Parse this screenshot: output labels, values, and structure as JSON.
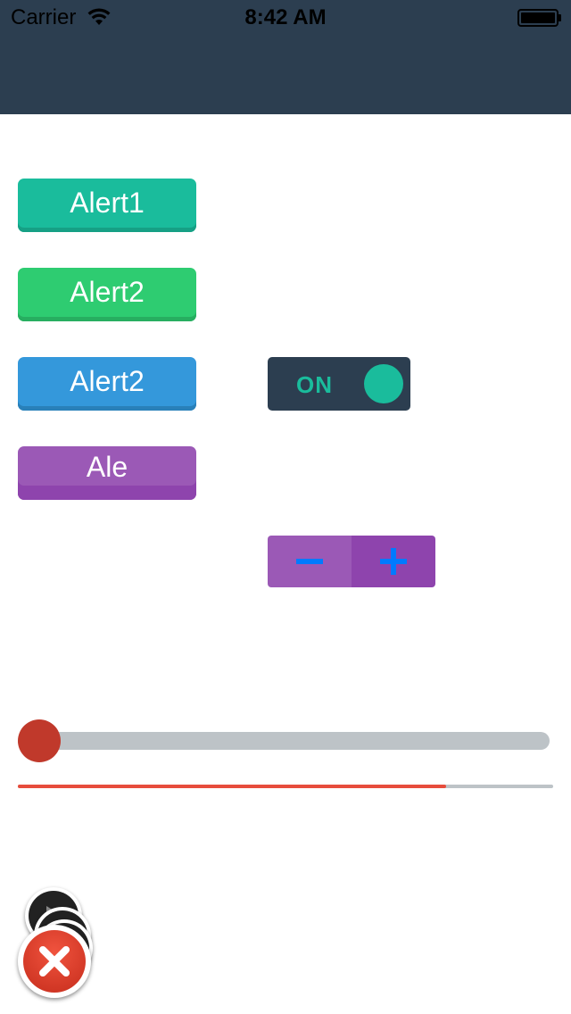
{
  "status_bar": {
    "carrier": "Carrier",
    "time": "8:42 AM",
    "icons": [
      "wifi-icon",
      "battery-icon"
    ]
  },
  "nav_bar": {
    "color": "#2c3e50"
  },
  "buttons": [
    {
      "label": "Alert1",
      "color": "#1abc9c"
    },
    {
      "label": "Alert2",
      "color": "#2ecc71"
    },
    {
      "label": "Alert2",
      "color": "#3498db"
    },
    {
      "label": "Ale",
      "color": "#9b59b6"
    }
  ],
  "toggle": {
    "label": "ON",
    "state": "on",
    "color": "#1abc9c"
  },
  "stepper": {
    "minus_icon": "minus-icon",
    "plus_icon": "plus-icon",
    "icon_color": "#007aff"
  },
  "slider": {
    "value": 0.0,
    "thumb_color": "#c0392b",
    "track_color": "#bdc3c7"
  },
  "progress": {
    "value": 0.8,
    "fill_color": "#e74c3c"
  },
  "floating_buttons": {
    "menu_items": [
      "play-icon",
      "camera-icon",
      "music-icon"
    ],
    "main_icon": "close-icon"
  }
}
